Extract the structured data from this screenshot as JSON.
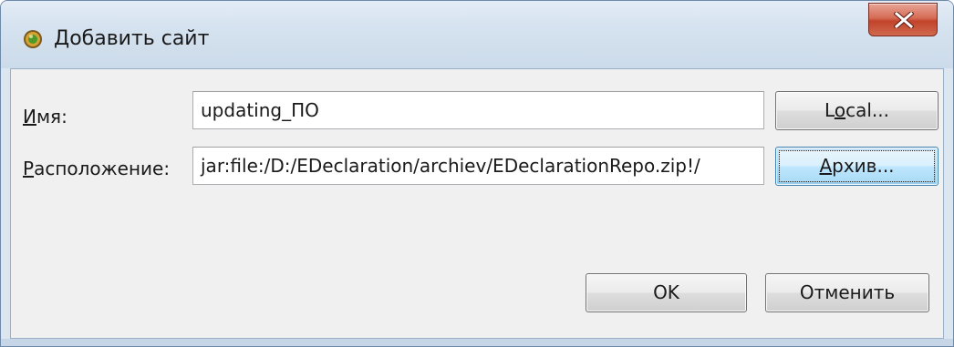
{
  "window": {
    "title": "Добавить сайт",
    "icon": "eclipse-install-icon",
    "close_icon": "close-x-icon"
  },
  "form": {
    "name": {
      "label_mnemonic": "И",
      "label_rest": "мя:",
      "value": "updating_ПО"
    },
    "location": {
      "label_mnemonic": "Р",
      "label_rest": "асположение:",
      "value": "jar:file:/D:/EDeclaration/archiev/EDeclarationRepo.zip!/"
    },
    "local_button": {
      "pre": "L",
      "mnemonic": "o",
      "post": "cal..."
    },
    "archive_button": {
      "mnemonic": "А",
      "post": "рхив..."
    }
  },
  "footer": {
    "ok_label": "OK",
    "cancel_label": "Отменить"
  },
  "colors": {
    "window_frame": "#dbe6f1",
    "content_bg": "#f0f0f0",
    "close_button": "#c2432a",
    "focused_button": "#bee6fd"
  }
}
